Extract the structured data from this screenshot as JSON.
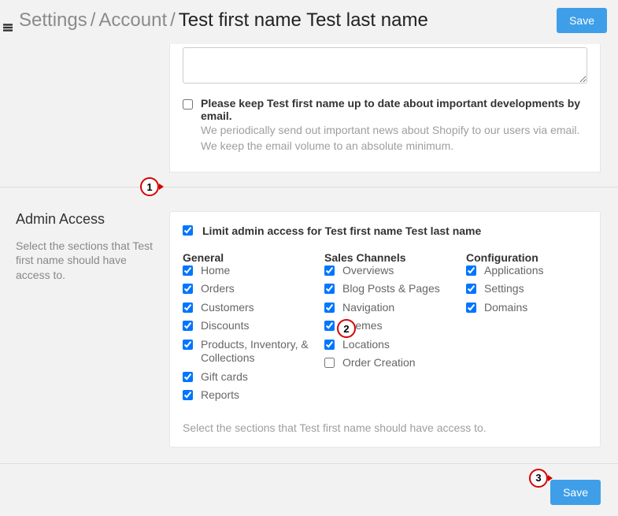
{
  "breadcrumb": {
    "l1": "Settings",
    "l2": "Account",
    "current": "Test first name Test last name",
    "sep": "/"
  },
  "buttons": {
    "save": "Save",
    "save_bottom": "Save"
  },
  "email_opt": {
    "label": "Please keep Test first name up to date about important developments by email.",
    "desc": "We periodically send out important news about Shopify to our users via email. We keep the email volume to an absolute minimum."
  },
  "admin": {
    "title": "Admin Access",
    "desc": "Select the sections that Test first name should have access to.",
    "limit_label": "Limit admin access for Test first name Test last name",
    "help": "Select the sections that Test first name should have access to.",
    "cols": {
      "general": {
        "title": "General",
        "items": [
          "Home",
          "Orders",
          "Customers",
          "Discounts",
          "Products, Inventory, & Collections",
          "Gift cards",
          "Reports"
        ],
        "checked": [
          true,
          true,
          true,
          true,
          true,
          true,
          true
        ]
      },
      "sales": {
        "title": "Sales Channels",
        "items": [
          "Overviews",
          "Blog Posts & Pages",
          "Navigation",
          "Themes",
          "Locations",
          "Order Creation"
        ],
        "checked": [
          true,
          true,
          true,
          true,
          true,
          false
        ]
      },
      "config": {
        "title": "Configuration",
        "items": [
          "Applications",
          "Settings",
          "Domains"
        ],
        "checked": [
          true,
          true,
          true
        ]
      }
    }
  },
  "markers": {
    "m1": "1",
    "m2": "2",
    "m3": "3"
  }
}
